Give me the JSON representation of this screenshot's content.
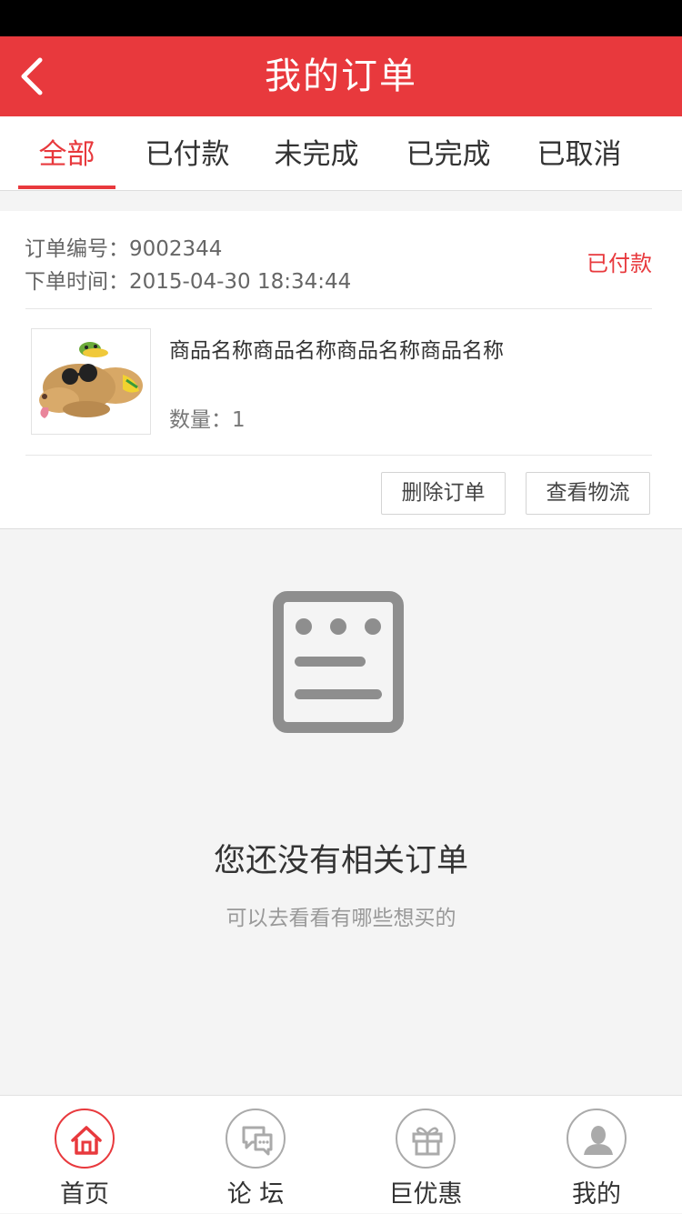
{
  "header": {
    "title": "我的订单",
    "back_icon": "chevron-left-icon"
  },
  "tabs": [
    {
      "label": "全部",
      "active": true
    },
    {
      "label": "已付款",
      "active": false
    },
    {
      "label": "未完成",
      "active": false
    },
    {
      "label": "已完成",
      "active": false
    },
    {
      "label": "已取消",
      "active": false
    }
  ],
  "order": {
    "number_label": "订单编号：",
    "number": "9002344",
    "time_label": "下单时间：",
    "time": "2015-04-30 18:34:44",
    "status": "已付款",
    "product": {
      "name": "商品名称商品名称商品名称商品名称",
      "qty_label": "数量：",
      "qty": "1"
    },
    "actions": {
      "delete": "删除订单",
      "logistics": "查看物流"
    }
  },
  "empty_state": {
    "icon": "document-icon",
    "title": "您还没有相关订单",
    "subtitle": "可以去看看有哪些想买的"
  },
  "tabbar": [
    {
      "label": "首页",
      "icon": "home-icon",
      "active": true
    },
    {
      "label": "论 坛",
      "icon": "chat-icon",
      "active": false
    },
    {
      "label": "巨优惠",
      "icon": "gift-icon",
      "active": false
    },
    {
      "label": "我的",
      "icon": "user-icon",
      "active": false
    }
  ],
  "colors": {
    "accent": "#e8393d",
    "background": "#f4f4f4"
  }
}
